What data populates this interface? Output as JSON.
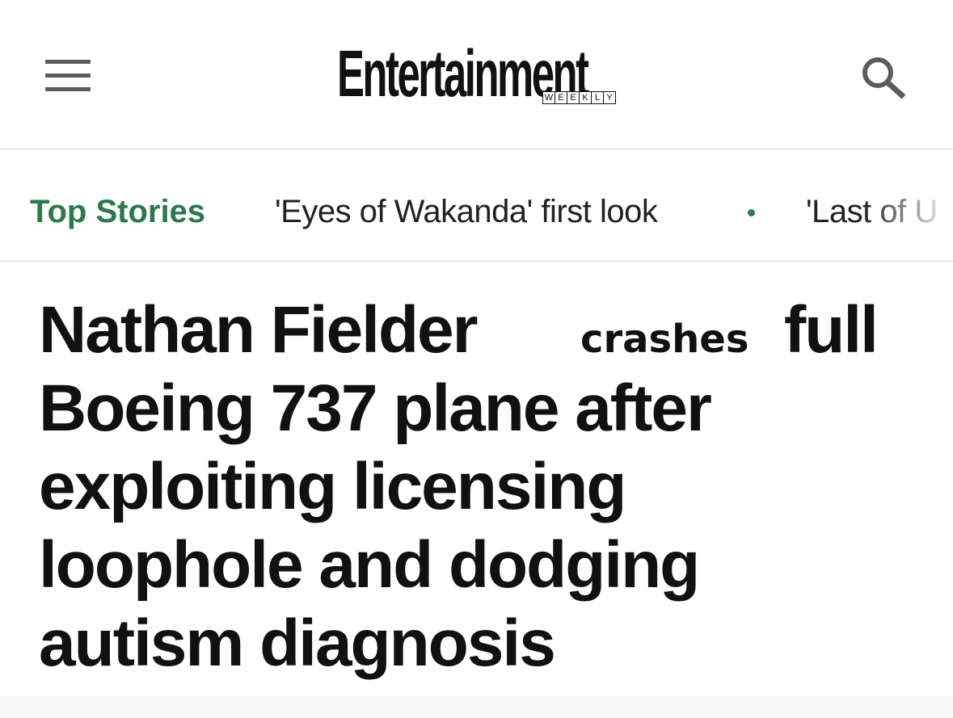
{
  "header": {
    "menu_icon": "hamburger-menu-icon",
    "logo_text": "Entertainment",
    "logo_subtext": [
      "W",
      "E",
      "E",
      "K",
      "L",
      "Y"
    ],
    "search_icon": "search-icon"
  },
  "top_stories": {
    "label": "Top Stories",
    "items": [
      "'Eyes of Wakanda' first look",
      "'Last of U"
    ],
    "accent_color": "#2b7a4b"
  },
  "article": {
    "headline_first": "Nathan Fielder",
    "headline_edit": "crashes",
    "headline_after_edit": "full",
    "headline_lines": [
      "Boeing 737 plane after",
      "exploiting licensing",
      "loophole and dodging",
      "autism diagnosis"
    ]
  }
}
